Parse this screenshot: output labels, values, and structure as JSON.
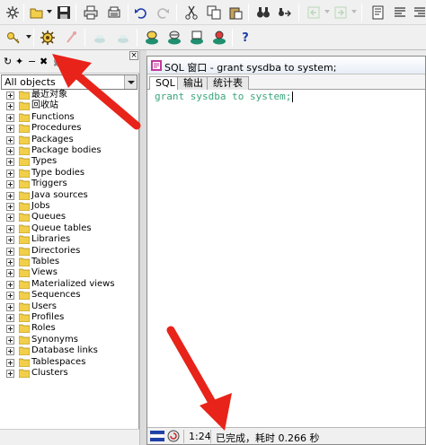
{
  "toolbar_top": {
    "icons": [
      "new-icon",
      "open-icon",
      "save-icon",
      "print-icon",
      "print-preview-icon",
      "undo-icon",
      "redo-icon",
      "cut-icon",
      "copy-icon",
      "paste-icon",
      "find-icon",
      "find-next-icon",
      "back-icon",
      "forward-icon",
      "edit-icon",
      "comment-icon",
      "uncomment-icon"
    ]
  },
  "toolbar_second": {
    "icons": [
      "session-key-icon",
      "execute-gear-icon",
      "stop-icon",
      "rollback-icon",
      "commit-icon",
      "db-sql-icon",
      "db-plsql-icon",
      "db-report-icon",
      "db-window-icon",
      "help-icon"
    ],
    "help_label": "?"
  },
  "object_browser": {
    "tool_labels": [
      "↻",
      "✦",
      "−",
      "✖",
      "⛓"
    ],
    "filter": "All objects",
    "close_label": "×",
    "items": [
      {
        "label": "最近对象"
      },
      {
        "label": "回收站"
      },
      {
        "label": "Functions"
      },
      {
        "label": "Procedures"
      },
      {
        "label": "Packages"
      },
      {
        "label": "Package bodies"
      },
      {
        "label": "Types"
      },
      {
        "label": "Type bodies"
      },
      {
        "label": "Triggers"
      },
      {
        "label": "Java sources"
      },
      {
        "label": "Jobs"
      },
      {
        "label": "Queues"
      },
      {
        "label": "Queue tables"
      },
      {
        "label": "Libraries"
      },
      {
        "label": "Directories"
      },
      {
        "label": "Tables"
      },
      {
        "label": "Views"
      },
      {
        "label": "Materialized views"
      },
      {
        "label": "Sequences"
      },
      {
        "label": "Users"
      },
      {
        "label": "Profiles"
      },
      {
        "label": "Roles"
      },
      {
        "label": "Synonyms"
      },
      {
        "label": "Database links"
      },
      {
        "label": "Tablespaces"
      },
      {
        "label": "Clusters"
      }
    ]
  },
  "sql_window": {
    "title": "SQL 窗口 - grant sysdba to system;",
    "tabs": [
      "SQL",
      "输出",
      "统计表"
    ],
    "code": "grant sysdba to system;",
    "status": {
      "position": "1:24",
      "message": "已完成，耗时 0.266 秒"
    }
  },
  "colors": {
    "code": "#3aa67a",
    "arrow": "#e8231a",
    "folder": "#f2cf4a"
  }
}
